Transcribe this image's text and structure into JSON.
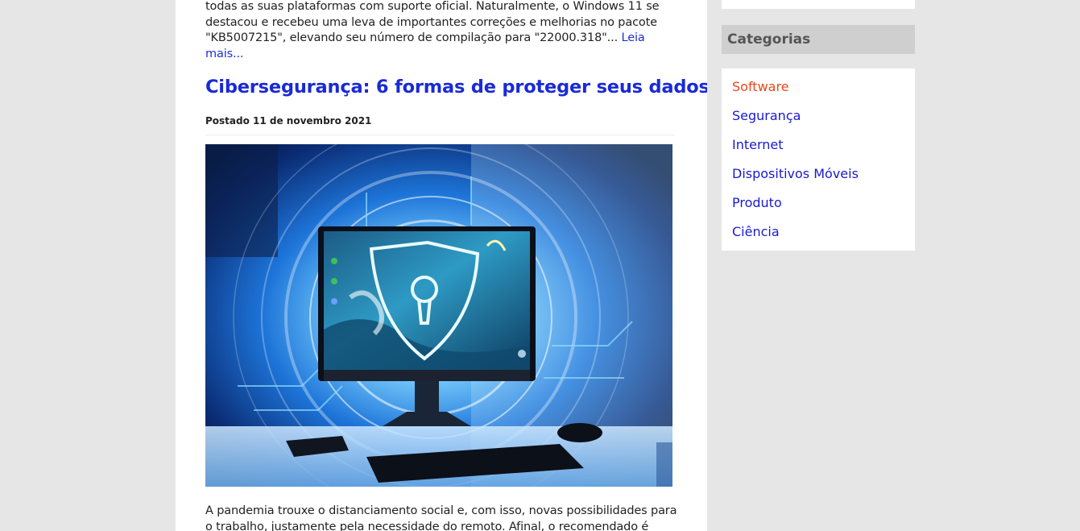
{
  "previous_post": {
    "lines": [
      "todas as suas plataformas com suporte oficial. Naturalmente, o Windows 11 se",
      "destacou e recebeu uma leva de importantes correções e melhorias no pacote",
      "\"KB5007215\", elevando seu número de compilação para \"22000.318\"..."
    ],
    "read_more_part1": "Leia",
    "read_more_part2": "mais..."
  },
  "post": {
    "title": "Cibersegurança: 6 formas de proteger seus dados",
    "date": "Postado 11 de novembro 2021",
    "excerpt_lines": [
      "A pandemia trouxe o distanciamento social e, com isso, novas possibilidades para",
      "o trabalho, justamente pela necessidade do remoto. Afinal, o recomendado é"
    ]
  },
  "sidebar": {
    "categories_title": "Categorias",
    "categories": [
      {
        "label": "Software",
        "active": true
      },
      {
        "label": "Segurança",
        "active": false
      },
      {
        "label": "Internet",
        "active": false
      },
      {
        "label": "Dispositivos Móveis",
        "active": false
      },
      {
        "label": "Produto",
        "active": false
      },
      {
        "label": "Ciência",
        "active": false
      }
    ]
  },
  "colors": {
    "link": "#1a2ad6",
    "active_category": "#e8481c",
    "page_background": "#e6e6e6",
    "sidebar_header": "#cfcfcf"
  }
}
